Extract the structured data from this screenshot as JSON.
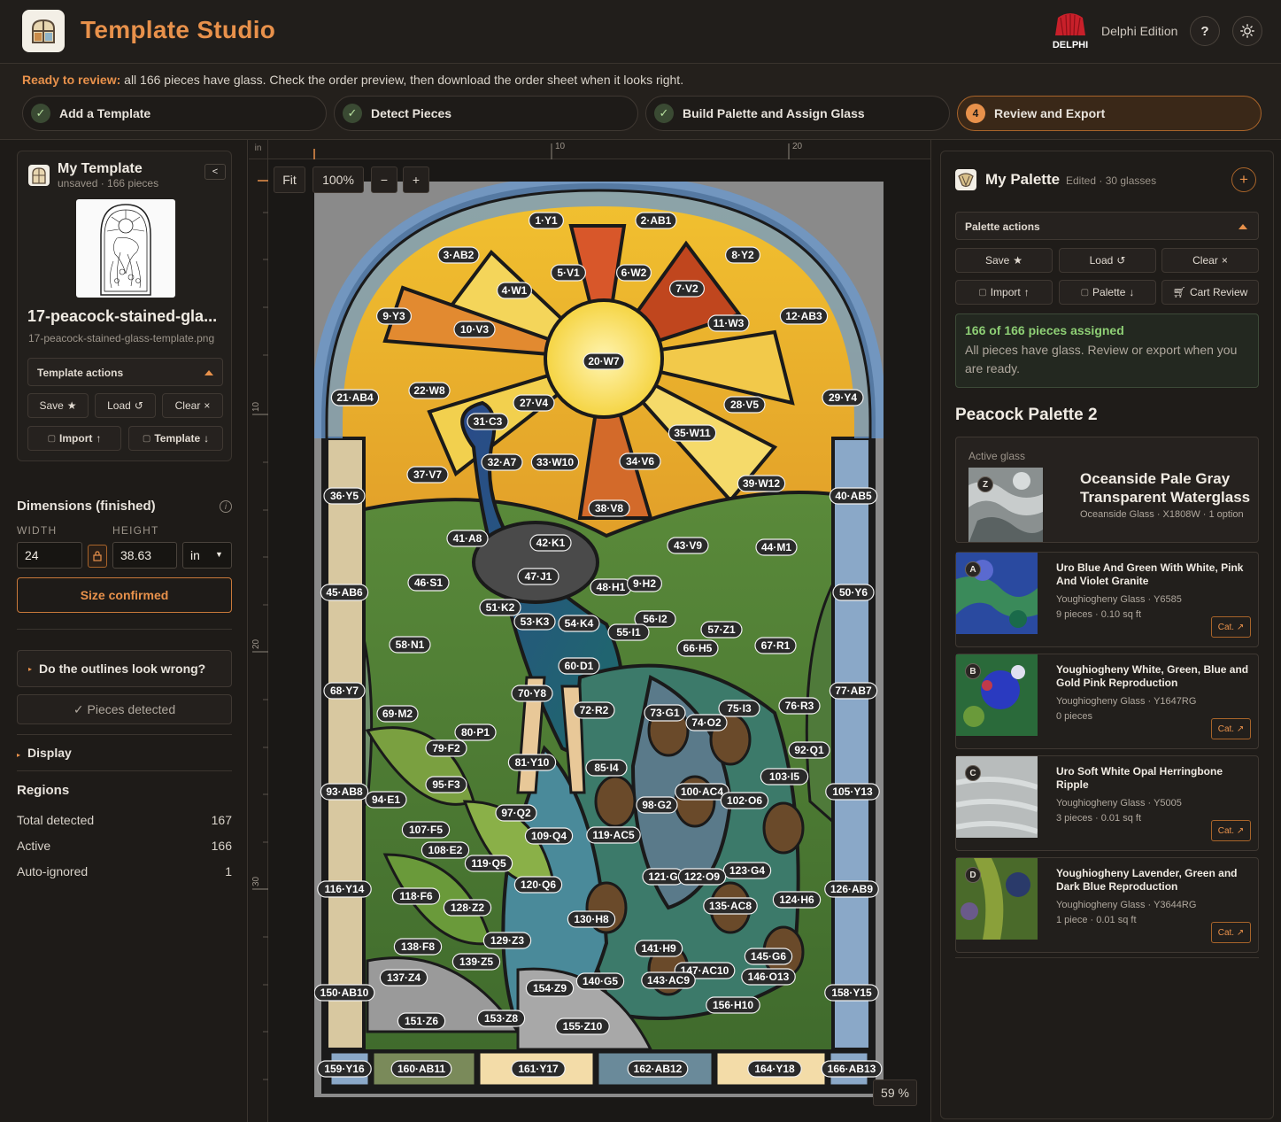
{
  "header": {
    "title": "Template Studio",
    "edition": "Delphi Edition",
    "brand_logo_text": "DELPHI",
    "help_label": "?",
    "accent": "#e8914b"
  },
  "status": {
    "lead": "Ready to review:",
    "message": "all 166 pieces have glass. Check the order preview, then download the order sheet when it looks right."
  },
  "steps": [
    {
      "label": "Add a Template",
      "state": "done"
    },
    {
      "label": "Detect Pieces",
      "state": "done"
    },
    {
      "label": "Build Palette and Assign Glass",
      "state": "done"
    },
    {
      "label": "Review and Export",
      "state": "active",
      "number": "4"
    }
  ],
  "template": {
    "title": "My Template",
    "status": "unsaved",
    "pieces": "166 pieces",
    "file_title": "17-peacock-stained-gla...",
    "file_name": "17-peacock-stained-glass-template.png",
    "actions_label": "Template actions",
    "save": "Save",
    "load": "Load",
    "clear": "Clear",
    "import": "Import",
    "template_btn": "Template"
  },
  "dimensions": {
    "heading": "Dimensions (finished)",
    "width_label": "WIDTH",
    "height_label": "HEIGHT",
    "width": "24",
    "height": "38.63",
    "unit": "in",
    "confirm": "Size confirmed"
  },
  "outlines": {
    "question": "Do the outlines look wrong?",
    "detected": "✓ Pieces detected"
  },
  "display": {
    "label": "Display"
  },
  "regions": {
    "heading": "Regions",
    "rows": [
      {
        "label": "Total detected",
        "value": "167"
      },
      {
        "label": "Active",
        "value": "166"
      },
      {
        "label": "Auto-ignored",
        "value": "1"
      }
    ]
  },
  "canvas": {
    "ruler_unit": "in",
    "ruler_top_ticks": [
      "10",
      "20"
    ],
    "ruler_left_ticks": [
      "10",
      "20",
      "30"
    ],
    "fit": "Fit",
    "zoom": "100%",
    "minus": "−",
    "plus": "+",
    "zoom_readout": "59 %",
    "piece_labels": [
      "1·Y1",
      "2·AB1",
      "3·AB2",
      "8·Y2",
      "5·V1",
      "6·W2",
      "4·W1",
      "7·V2",
      "9·Y3",
      "12·AB3",
      "10·V3",
      "11·W3",
      "20·W7",
      "21·AB4",
      "22·W8",
      "27·V4",
      "28·V5",
      "29·Y4",
      "31·C3",
      "35·W11",
      "37·V7",
      "32·A7",
      "33·W10",
      "34·V6",
      "39·W12",
      "36·Y5",
      "40·AB5",
      "38·V8",
      "41·A8",
      "42·K1",
      "43·V9",
      "44·M1",
      "45·AB6",
      "46·S1",
      "47·J1",
      "48·H1",
      "9·H2",
      "50·Y6",
      "51·K2",
      "53·K3",
      "54·K4",
      "56·I2",
      "57·Z1",
      "55·I1",
      "58·N1",
      "66·H5",
      "67·R1",
      "60·D1",
      "68·Y7",
      "70·Y8",
      "77·AB7",
      "69·M2",
      "72·R2",
      "73·G1",
      "75·I3",
      "76·R3",
      "80·P1",
      "74·O2",
      "79·F2",
      "92·Q1",
      "81·Y10",
      "85·I4",
      "103·I5",
      "93·AB8",
      "95·F3",
      "94·E1",
      "100·AC4",
      "102·O6",
      "105·Y13",
      "97·Q2",
      "98·G2",
      "107·F5",
      "109·Q4",
      "119·AC5",
      "108·E2",
      "119·Q5",
      "123·G4",
      "121·G",
      "122·O9",
      "116·Y14",
      "126·AB9",
      "118·F6",
      "120·Q6",
      "124·H6",
      "128·Z2",
      "130·H8",
      "135·AC8",
      "138·F8",
      "129·Z3",
      "139·Z5",
      "141·H9",
      "147·AC10",
      "145·G6",
      "137·Z4",
      "146·O13",
      "150·AB10",
      "154·Z9",
      "140·G5",
      "143·AC9",
      "158·Y15",
      "156·H10",
      "151·Z6",
      "153·Z8",
      "155·Z10",
      "159·Y16",
      "160·AB11",
      "161·Y17",
      "162·AB12",
      "164·Y18",
      "166·AB13"
    ]
  },
  "palette": {
    "title": "My Palette",
    "edited": "Edited",
    "count": "30 glasses",
    "actions_label": "Palette actions",
    "save": "Save",
    "load": "Load",
    "clear": "Clear",
    "import": "Import",
    "palette_btn": "Palette",
    "cart": "Cart Review",
    "assigned_title": "166 of 166 pieces assigned",
    "assigned_desc": "All pieces have glass. Review or export when you are ready.",
    "name": "Peacock Palette 2",
    "active": {
      "label": "Active glass",
      "letter": "Z",
      "name": "Oceanside Pale Gray Transparent Waterglass",
      "sub": "Oceanside Glass · X1808W · 1 option"
    },
    "glasses": [
      {
        "letter": "A",
        "name": "Uro Blue And Green With White, Pink And Violet Granite",
        "maker": "Youghiogheny Glass · Y6585",
        "pieces": "9 pieces · 0.10 sq ft",
        "cat": "Cat. ↗"
      },
      {
        "letter": "B",
        "name": "Youghiogheny White, Green, Blue and Gold Pink Reproduction",
        "maker": "Youghiogheny Glass · Y1647RG",
        "pieces": "0 pieces",
        "cat": "Cat. ↗"
      },
      {
        "letter": "C",
        "name": "Uro Soft White Opal Herringbone Ripple",
        "maker": "Youghiogheny Glass · Y5005",
        "pieces": "3 pieces · 0.01 sq ft",
        "cat": "Cat. ↗"
      },
      {
        "letter": "D",
        "name": "Youghiogheny Lavender, Green and Dark Blue Reproduction",
        "maker": "Youghiogheny Glass · Y3644RG",
        "pieces": "1 piece · 0.01 sq ft",
        "cat": "Cat. ↗"
      }
    ]
  }
}
